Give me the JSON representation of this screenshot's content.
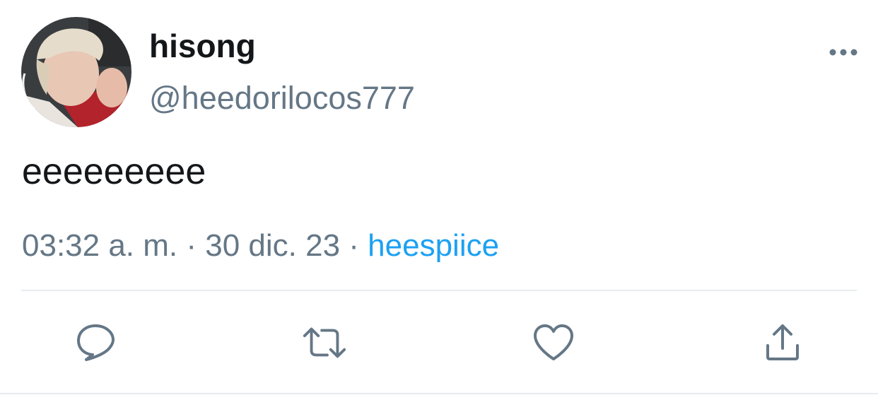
{
  "author": {
    "display_name": "hisong",
    "handle": "@heedorilocos777",
    "avatar_icon": "user-avatar-photo"
  },
  "tweet": {
    "text": "eeeeeeeee",
    "time": "03:32 a. m.",
    "date": "30 dic. 23",
    "separator": " · ",
    "source": "heespiice"
  },
  "actions": [
    {
      "name": "reply",
      "icon": "speech-bubble-icon"
    },
    {
      "name": "retweet",
      "icon": "retweet-arrows-icon"
    },
    {
      "name": "like",
      "icon": "heart-icon"
    },
    {
      "name": "share",
      "icon": "share-upload-icon"
    }
  ],
  "menu": {
    "icon": "more-options-icon"
  },
  "colors": {
    "text": "#14171a",
    "secondary": "#657786",
    "link": "#1da1f2",
    "divider": "#e6ecf0"
  }
}
